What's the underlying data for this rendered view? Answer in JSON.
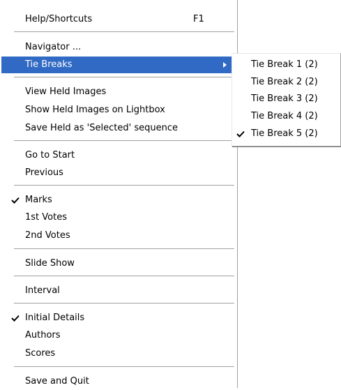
{
  "menu": {
    "help": {
      "label": "Help/Shortcuts",
      "shortcut": "F1"
    },
    "navigator": "Navigator ...",
    "tie_breaks": "Tie Breaks",
    "view_held": "View Held Images",
    "show_held_lightbox": "Show Held Images on Lightbox",
    "save_held_selected": "Save Held as 'Selected' sequence",
    "go_to_start": "Go to Start",
    "previous": "Previous",
    "marks": "Marks",
    "votes_1st": "1st Votes",
    "votes_2nd": "2nd Votes",
    "slide_show": "Slide Show",
    "interval": "Interval",
    "initial_details": "Initial Details",
    "authors": "Authors",
    "scores": "Scores",
    "save_and_quit": "Save and Quit"
  },
  "submenu": {
    "items": [
      {
        "label": "Tie Break 1 (2)",
        "checked": false
      },
      {
        "label": "Tie Break 2 (2)",
        "checked": false
      },
      {
        "label": "Tie Break 3 (2)",
        "checked": false
      },
      {
        "label": "Tie Break 4 (2)",
        "checked": false
      },
      {
        "label": "Tie Break 5 (2)",
        "checked": true
      }
    ]
  },
  "icons": {
    "check": "check-icon",
    "submenu_arrow": "chevron-right-icon"
  },
  "colors": {
    "highlight": "#316ac5",
    "highlight_text": "#ffffff",
    "separator": "#a0a0a0"
  }
}
